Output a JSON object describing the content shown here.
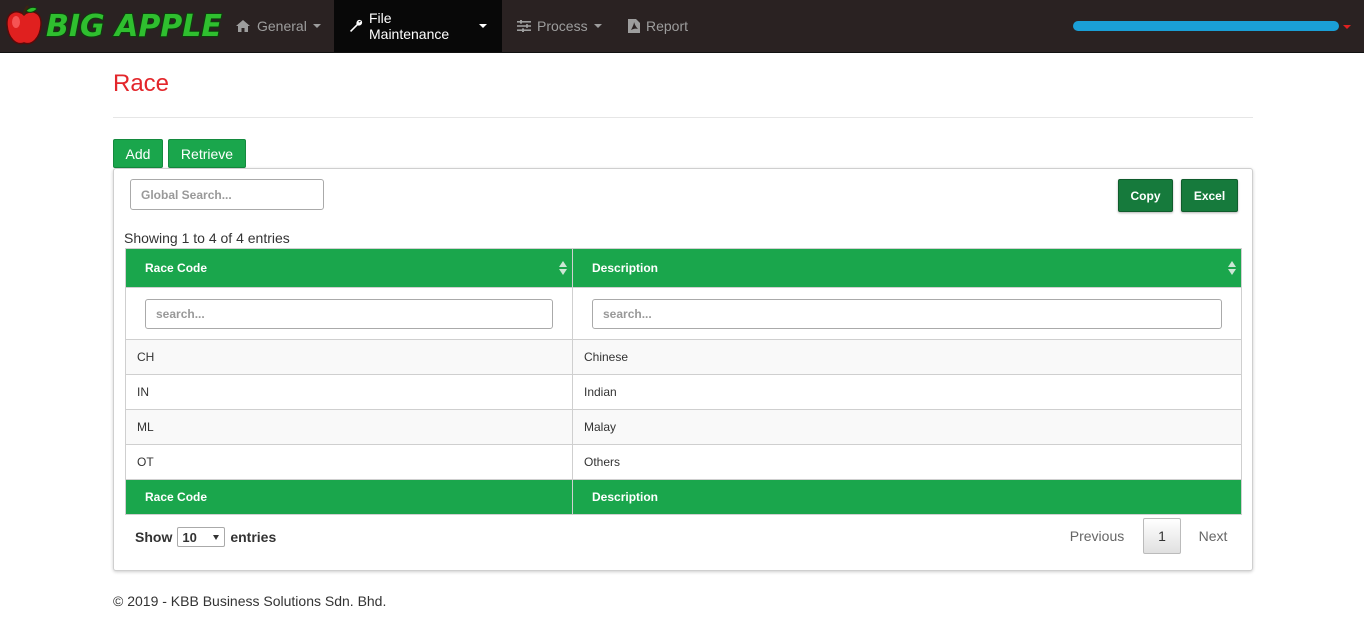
{
  "navbar": {
    "brand": "BIG APPLE",
    "items": [
      {
        "label": "General",
        "icon": "home-icon"
      },
      {
        "label": "File Maintenance",
        "icon": "wrench-icon"
      },
      {
        "label": "Process",
        "icon": "sliders-icon"
      },
      {
        "label": "Report",
        "icon": "pdf-file-icon"
      }
    ]
  },
  "page": {
    "title": "Race",
    "add_label": "Add",
    "retrieve_label": "Retrieve"
  },
  "table_panel": {
    "global_search_placeholder": "Global Search...",
    "copy_label": "Copy",
    "excel_label": "Excel",
    "showing_text": "Showing 1 to 4 of 4 entries",
    "columns": [
      "Race Code",
      "Description"
    ],
    "column_search_placeholder": "search...",
    "rows": [
      [
        "CH",
        "Chinese"
      ],
      [
        "IN",
        "Indian"
      ],
      [
        "ML",
        "Malay"
      ],
      [
        "OT",
        "Others"
      ]
    ],
    "show_label": "Show",
    "entries_label": "entries",
    "page_size": "10",
    "pagination": {
      "previous": "Previous",
      "current": "1",
      "next": "Next"
    }
  },
  "footer": {
    "text": "© 2019 - KBB Business Solutions Sdn. Bhd."
  },
  "colors": {
    "accent_green": "#1aa64c",
    "dark_green": "#167a3c",
    "title_red": "#e3262b",
    "navbar": "#2a2222"
  }
}
